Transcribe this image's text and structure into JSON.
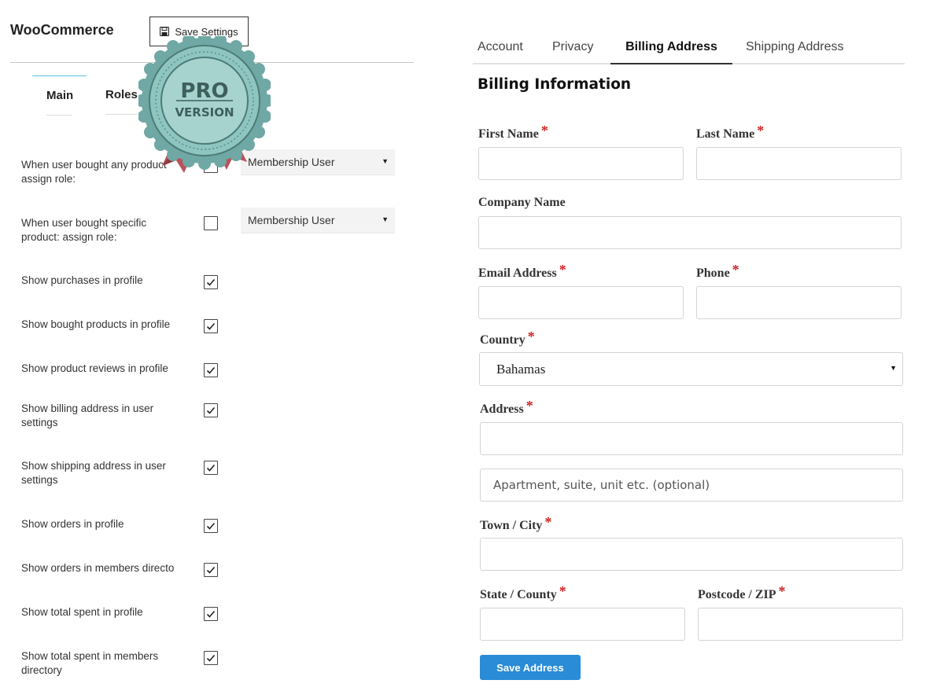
{
  "left": {
    "title": "WooCommerce",
    "save_settings_label": "Save Settings",
    "subtabs": [
      {
        "label": "Main"
      },
      {
        "label": "Roles"
      }
    ],
    "badge": {
      "line1": "PRO",
      "line2": "VERSION"
    },
    "role_dropdown_1": "Membership User",
    "role_dropdown_2": "Membership User",
    "options": [
      {
        "label": "When user bought any product assign role:",
        "checked": false
      },
      {
        "label": "When user bought specific product: assign role:",
        "checked": false
      },
      {
        "label": "Show purchases in profile",
        "checked": true
      },
      {
        "label": "Show bought products in profile",
        "checked": true
      },
      {
        "label": "Show product reviews in profile",
        "checked": true
      },
      {
        "label": "Show billing address in user settings",
        "checked": true
      },
      {
        "label": "Show shipping address in user settings",
        "checked": true
      },
      {
        "label": "Show orders in profile",
        "checked": true
      },
      {
        "label": "Show orders in members directo",
        "checked": true
      },
      {
        "label": "Show total spent in profile",
        "checked": true
      },
      {
        "label": "Show total spent in members directory",
        "checked": true
      }
    ]
  },
  "right": {
    "tabs": [
      {
        "label": "Account"
      },
      {
        "label": "Privacy"
      },
      {
        "label": "Billing Address"
      },
      {
        "label": "Shipping Address"
      }
    ],
    "active_tab": "Billing Address",
    "section_title": "Billing Information",
    "required_mark": "*",
    "fields": {
      "first_name": {
        "label": "First Name",
        "value": ""
      },
      "last_name": {
        "label": "Last Name",
        "value": ""
      },
      "company": {
        "label": "Company Name",
        "value": ""
      },
      "email": {
        "label": "Email Address",
        "value": ""
      },
      "phone": {
        "label": "Phone",
        "value": ""
      },
      "country": {
        "label": "Country",
        "value": "Bahamas"
      },
      "address": {
        "label": "Address",
        "value": "",
        "line2_placeholder": "Apartment, suite, unit etc. (optional)"
      },
      "city": {
        "label": "Town / City",
        "value": ""
      },
      "state": {
        "label": "State / County",
        "value": ""
      },
      "postcode": {
        "label": "Postcode / ZIP",
        "value": ""
      }
    },
    "save_button_label": "Save Address"
  },
  "colors": {
    "primary_button": "#2a8bd6",
    "required": "#cc2222",
    "badge_teal": "#8fc5c0",
    "badge_ribbon": "#b9525a"
  }
}
